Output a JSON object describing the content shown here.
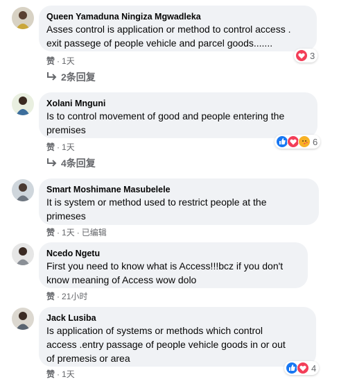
{
  "comments": [
    {
      "author": "Queen Yamaduna Ningiza Mgwadleka",
      "text": "Asses control is application or method to control access .\nexit passege of people vehicle and parcel goods.......",
      "like_label": "赞",
      "time": "1天",
      "reaction_count": "3",
      "reactions": [
        "heart"
      ],
      "replies_label": "2条回复"
    },
    {
      "author": "Xolani Mnguni",
      "text": "Is to control movement of good and people entering the\npremises",
      "like_label": "赞",
      "time": "1天",
      "reaction_count": "6",
      "reactions": [
        "like",
        "heart",
        "care"
      ],
      "replies_label": "4条回复"
    },
    {
      "author": "Smart Moshimane Masubelele",
      "text": "It is system or method used to restrict people at the\nprimeses",
      "like_label": "赞",
      "time": "1天",
      "edited_label": "已编辑"
    },
    {
      "author": "Ncedo Ngetu",
      "text": "First you need to know what is Access!!!bcz if you don't\nknow meaning of Access wow dolo",
      "like_label": "赞",
      "time": "21小时"
    },
    {
      "author": "Jack Lusiba",
      "text": "Is application of systems or methods which control\naccess .entry passage of people vehicle goods in or out\nof premesis or area",
      "like_label": "赞",
      "time": "1天",
      "reaction_count": "4",
      "reactions": [
        "like",
        "heart"
      ]
    }
  ],
  "colors": {
    "like_blue": "#1877f2",
    "heart_red": "#f33e58",
    "care_yellow": "#f7b125",
    "bubble_bg": "#f0f2f5",
    "meta_gray": "#65676b"
  }
}
